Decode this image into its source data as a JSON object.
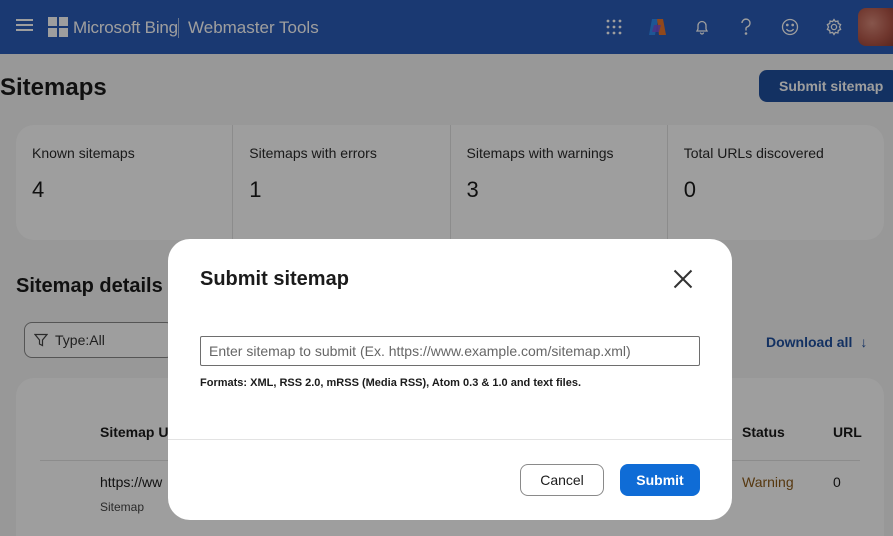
{
  "header": {
    "brand": "Microsoft Bing",
    "product": "Webmaster Tools",
    "icons": [
      "apps-grid-icon",
      "copilot-icon",
      "bell-icon",
      "help-icon",
      "feedback-smiley-icon",
      "settings-gear-icon"
    ]
  },
  "page": {
    "title": "Sitemaps",
    "submit_button": "Submit sitemap"
  },
  "stats": [
    {
      "label": "Known sitemaps",
      "value": "4"
    },
    {
      "label": "Sitemaps with errors",
      "value": "1"
    },
    {
      "label": "Sitemaps with warnings",
      "value": "3"
    },
    {
      "label": "Total URLs discovered",
      "value": "0"
    }
  ],
  "details": {
    "title": "Sitemap details",
    "filter": "Type:All",
    "download": "Download all",
    "columns": {
      "url": "Sitemap U",
      "status": "Status",
      "urls": "URL"
    },
    "rows": [
      {
        "url": "https://ww",
        "type": "Sitemap",
        "status": "Warning",
        "urls": "0"
      }
    ]
  },
  "modal": {
    "title": "Submit sitemap",
    "input_value": "",
    "input_placeholder": "Enter sitemap to submit (Ex. https://www.example.com/sitemap.xml)",
    "formats_note": "Formats: XML, RSS 2.0, mRSS (Media RSS), Atom 0.3 & 1.0 and text files.",
    "cancel": "Cancel",
    "submit": "Submit"
  },
  "colors": {
    "header_bg": "#2b5cb8",
    "primary_button": "#0f6cd6",
    "dark_button": "#20509e",
    "warning_text": "#8b5a18"
  }
}
